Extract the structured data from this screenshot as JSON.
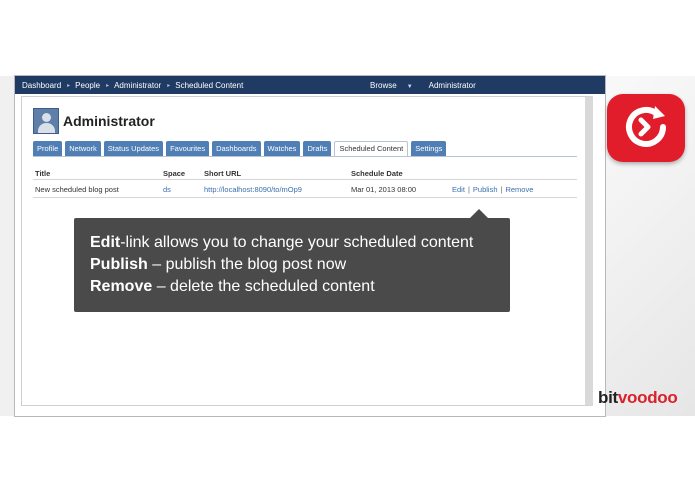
{
  "topbar": {
    "crumbs": [
      "Dashboard",
      "People",
      "Administrator",
      "Scheduled Content"
    ],
    "browse_label": "Browse",
    "user_label": "Administrator"
  },
  "profile": {
    "name": "Administrator"
  },
  "tabs": [
    {
      "label": "Profile",
      "active": false
    },
    {
      "label": "Network",
      "active": false
    },
    {
      "label": "Status Updates",
      "active": false
    },
    {
      "label": "Favourites",
      "active": false
    },
    {
      "label": "Dashboards",
      "active": false
    },
    {
      "label": "Watches",
      "active": false
    },
    {
      "label": "Drafts",
      "active": false
    },
    {
      "label": "Scheduled Content",
      "active": true
    },
    {
      "label": "Settings",
      "active": false
    }
  ],
  "table": {
    "headers": [
      "Title",
      "Space",
      "Short URL",
      "Schedule Date"
    ],
    "rows": [
      {
        "title": "New scheduled blog post",
        "space": "ds",
        "short_url": "http://localhost:8090/to/mOp9",
        "schedule_date": "Mar 01, 2013 08:00",
        "actions": [
          "Edit",
          "Publish",
          "Remove"
        ]
      }
    ]
  },
  "tooltip": {
    "line1_bold": "Edit",
    "line1_rest": "-link allows you to change your scheduled content",
    "line2_bold": "Publish",
    "line2_rest": " – publish the blog post now",
    "line3_bold": "Remove",
    "line3_rest": " – delete the scheduled content"
  },
  "branding": {
    "logo_part1": "bit",
    "logo_part2": "voodoo",
    "badge_icon": "refresh-clock-icon",
    "badge_color": "#e11d2b",
    "nav_color": "#1f3a63",
    "tab_color": "#4f7fb5"
  }
}
